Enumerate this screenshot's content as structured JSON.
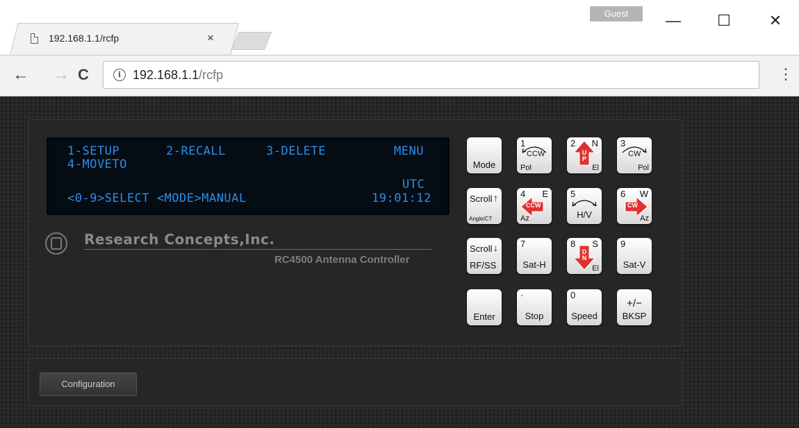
{
  "browser": {
    "profile": "Guest",
    "window_controls": {
      "minimize": "—",
      "maximize": "☐",
      "close": "✕"
    },
    "tab": {
      "title": "192.168.1.1/rcfp",
      "close": "×"
    },
    "nav": {
      "back": "←",
      "forward": "→",
      "reload": "C"
    },
    "address": {
      "host": "192.168.1.1",
      "path": "/rcfp"
    },
    "menu": "⋮"
  },
  "lcd": {
    "row1": {
      "c1": "1-SETUP",
      "c2": "2-RECALL",
      "c3": "3-DELETE",
      "c4": "MENU"
    },
    "row2": {
      "c1": "4-MOVETO"
    },
    "row3": {
      "c4": "UTC"
    },
    "row4": {
      "c1": "<0-9>SELECT <MODE>MANUAL",
      "c4": "19:01:12"
    }
  },
  "branding": {
    "company": "Research Concepts,Inc.",
    "model": "RC4500 Antenna Controller"
  },
  "keypad": {
    "mode": "Mode",
    "scroll_up": {
      "label": "Scroll",
      "sub": "Angle/CT"
    },
    "scroll_down": {
      "label": "Scroll",
      "sub": "RF/SS"
    },
    "enter": "Enter",
    "k1": {
      "num": "1",
      "arrow": "CCW",
      "sub": "Pol"
    },
    "k2": {
      "num": "2",
      "dir": "N",
      "arrow": "UP",
      "sub": "El"
    },
    "k3": {
      "num": "3",
      "arrow": "CW",
      "sub": "Pol"
    },
    "k4": {
      "num": "4",
      "dir": "E",
      "arrow": "CCW",
      "sub": "Az"
    },
    "k5": {
      "num": "5",
      "sub": "H/V"
    },
    "k6": {
      "num": "6",
      "dir": "W",
      "arrow": "CW",
      "sub": "Az"
    },
    "k7": {
      "num": "7",
      "sub": "Sat-H"
    },
    "k8": {
      "num": "8",
      "dir": "S",
      "arrow": "DN",
      "sub": "El"
    },
    "k9": {
      "num": "9",
      "sub": "Sat-V"
    },
    "kdot": {
      "num": "·",
      "sub": "Stop"
    },
    "k0": {
      "num": "0",
      "sub": "Speed"
    },
    "kpm": {
      "num": "+/−",
      "sub": "BKSP"
    }
  },
  "configuration_button": "Configuration",
  "colors": {
    "lcd_text": "#2a8fe8",
    "arrow_red": "#e03030",
    "panel": "#262626"
  }
}
